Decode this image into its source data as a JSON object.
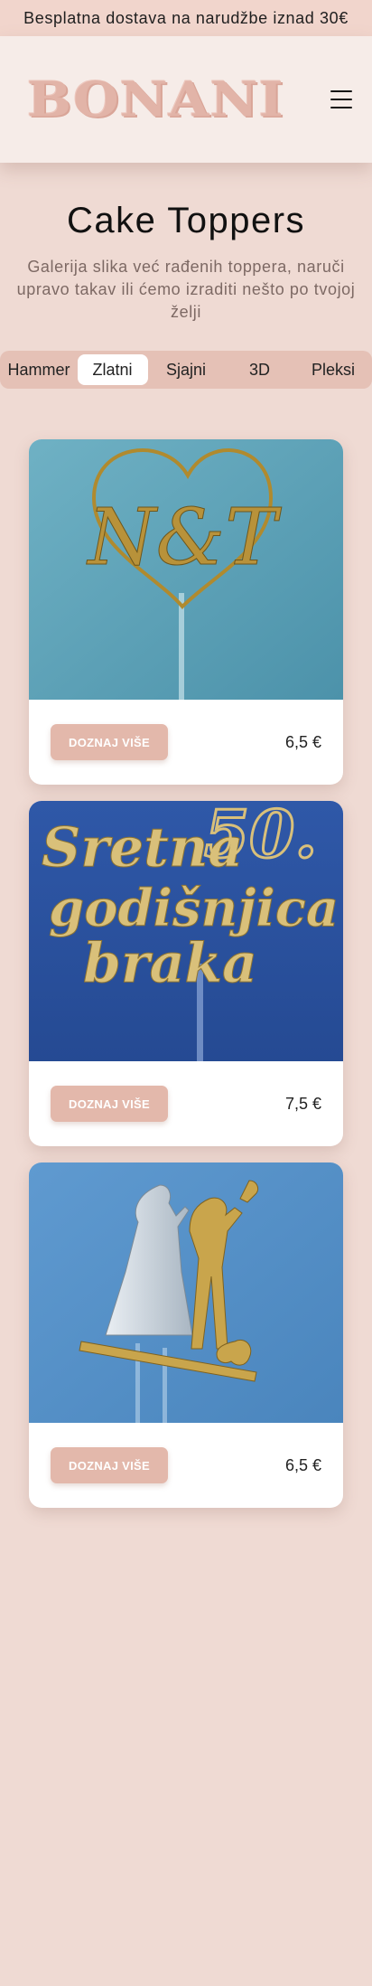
{
  "announcement": "Besplatna dostava na narudžbe iznad 30€",
  "brand": {
    "logo_text": "BONANI"
  },
  "hero": {
    "title": "Cake Toppers",
    "subtitle": "Galerija slika već rađenih toppera, naruči upravo takav ili ćemo izraditi nešto po tvojoj želji"
  },
  "tabs": [
    {
      "label": "Hammer",
      "active": false
    },
    {
      "label": "Zlatni",
      "active": true
    },
    {
      "label": "Sjajni",
      "active": false
    },
    {
      "label": "3D",
      "active": false
    },
    {
      "label": "Pleksi",
      "active": false
    }
  ],
  "products": [
    {
      "image_text": "N&T",
      "button_label": "DOZNAJ VIŠE",
      "price": "6,5 €"
    },
    {
      "image_text": "Sretna 50. godišnjica braka",
      "button_label": "DOZNAJ VIŠE",
      "price": "7,5 €"
    },
    {
      "image_text": "",
      "button_label": "DOZNAJ VIŠE",
      "price": "6,5 €"
    }
  ],
  "colors": {
    "page_bg": "#efdad3",
    "header_bg": "#f6ece8",
    "accent": "#e3b8ab",
    "gold": "#c9a24a"
  }
}
